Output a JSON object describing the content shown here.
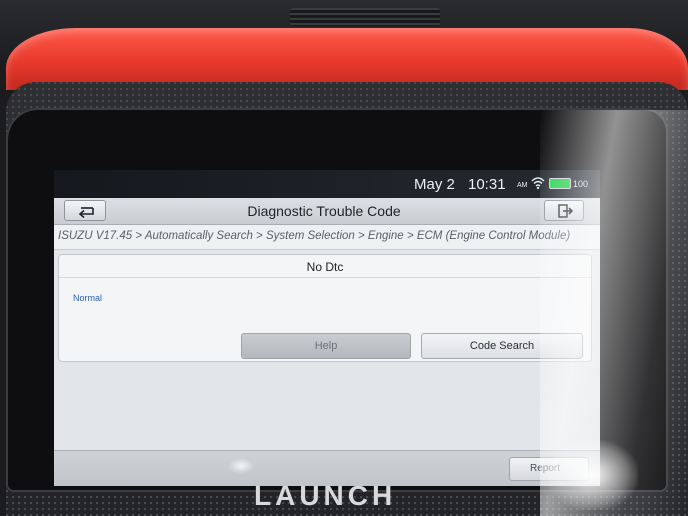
{
  "status_bar": {
    "date": "May 2",
    "time": "10:31",
    "ampm": "AM",
    "battery_percent": "100",
    "icons": [
      "wifi-icon",
      "battery-icon"
    ],
    "battery_color": "#23d04a"
  },
  "header": {
    "title": "Diagnostic Trouble Code",
    "back_icon": "back-arrow-icon",
    "exit_icon": "exit-icon"
  },
  "breadcrumb": "ISUZU V17.45 > Automatically Search > System Selection > Engine > ECM (Engine Control Module)",
  "result": {
    "dtc_status": "No Dtc",
    "system_status": "Normal",
    "status_color": "#2a5fb5"
  },
  "actions": {
    "help_label": "Help",
    "code_search_label": "Code Search"
  },
  "footer": {
    "report_label": "Report"
  },
  "device": {
    "brand": "LAUNCH",
    "bumper_color": "#e83a2c"
  }
}
